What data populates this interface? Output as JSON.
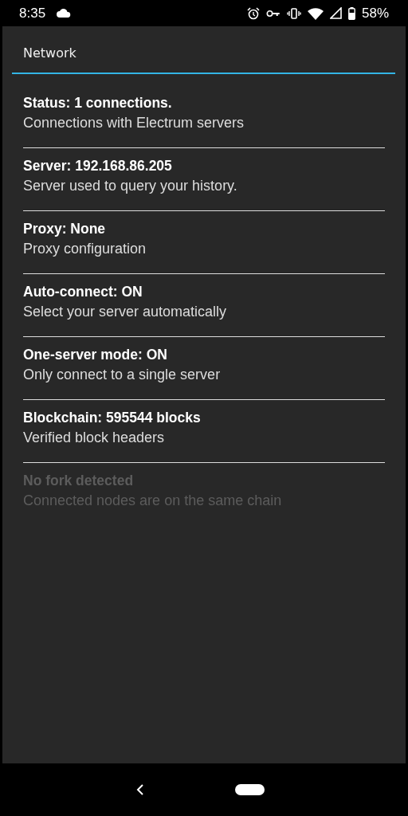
{
  "status_bar": {
    "time": "8:35",
    "battery": "58%"
  },
  "dialog": {
    "title": "Network"
  },
  "items": [
    {
      "title": "Status: 1 connections.",
      "summary": "Connections with Electrum servers",
      "disabled": false
    },
    {
      "title": "Server: 192.168.86.205",
      "summary": "Server used to query your history.",
      "disabled": false
    },
    {
      "title": "Proxy: None",
      "summary": "Proxy configuration",
      "disabled": false
    },
    {
      "title": "Auto-connect: ON",
      "summary": "Select your server automatically",
      "disabled": false
    },
    {
      "title": "One-server mode: ON",
      "summary": "Only connect to a single server",
      "disabled": false
    },
    {
      "title": "Blockchain: 595544 blocks",
      "summary": "Verified block headers",
      "disabled": false
    },
    {
      "title": "No fork detected",
      "summary": "Connected nodes are on the same chain",
      "disabled": true
    }
  ]
}
